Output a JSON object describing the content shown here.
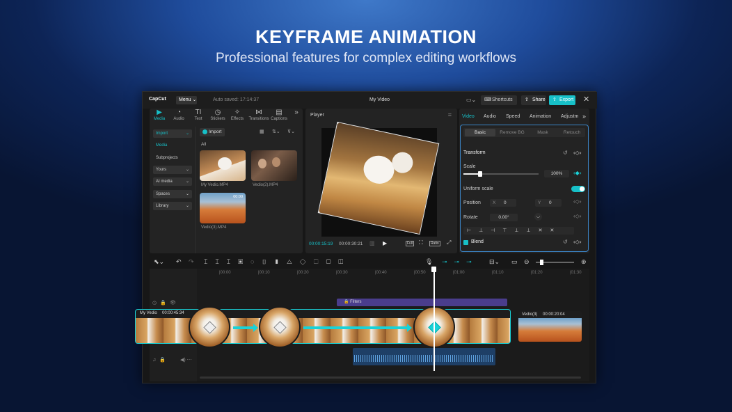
{
  "headline": "KEYFRAME ANIMATION",
  "subline": "Professional features for complex editing workflows",
  "titlebar": {
    "logo": "CapCut",
    "menu": "Menu",
    "autosave": "Auto saved: 17:14:37",
    "project_title": "My Video",
    "shortcuts": "Shortcuts",
    "share": "Share",
    "export": "Export"
  },
  "tools": [
    {
      "label": "Media",
      "icon": "▶"
    },
    {
      "label": "Audio",
      "icon": "◔"
    },
    {
      "label": "Text",
      "icon": "TI"
    },
    {
      "label": "Stickers",
      "icon": "◷"
    },
    {
      "label": "Effects",
      "icon": "✧"
    },
    {
      "label": "Transitions",
      "icon": "⋈"
    },
    {
      "label": "Captions",
      "icon": "▤"
    }
  ],
  "media_sidebar": [
    "Import",
    "Media",
    "Subprojects",
    "Yours",
    "AI media",
    "Spaces",
    "Library"
  ],
  "media": {
    "import_label": "Import",
    "filter_all": "All",
    "items": [
      {
        "name": "My Vedio.MP4"
      },
      {
        "name": "Vedio(2).MP4"
      },
      {
        "name": "Vedio(3).MP4",
        "duration": "00:00"
      }
    ]
  },
  "player": {
    "title": "Player",
    "current_time": "00:00:15:19",
    "total_time": "00:00:30:21",
    "full_label": "Full",
    "ratio_label": "Ratio"
  },
  "properties": {
    "tabs": [
      "Video",
      "Audio",
      "Speed",
      "Animation",
      "Adjustm"
    ],
    "subtabs": [
      "Basic",
      "Remove BG",
      "Mask",
      "Retouch"
    ],
    "transform_label": "Transform",
    "scale_label": "Scale",
    "scale_value": "100%",
    "scale_fraction": 0.22,
    "uniform_scale_label": "Uniform scale",
    "uniform_scale_on": true,
    "position_label": "Position",
    "pos_x_label": "X",
    "pos_x": "0",
    "pos_y_label": "Y",
    "pos_y": "0",
    "rotate_label": "Rotate",
    "rotate_value": "0.00°",
    "blend_label": "Blend"
  },
  "timeline": {
    "ticks": [
      "00:00",
      "00:10",
      "00:20",
      "00:30",
      "00:40",
      "00:50",
      "01:00",
      "01:10",
      "01:20",
      "01:30"
    ],
    "filter_label": "Filters",
    "clip1_name": "My Vedio",
    "clip1_duration": "00:00:45:34",
    "clip2_name": "Vedio(3)",
    "clip2_duration": "00:00:20:04"
  },
  "colors": {
    "accent": "#17c0c8",
    "filter_bar": "#4a3d8c",
    "audio_clip": "#1e3f66"
  }
}
